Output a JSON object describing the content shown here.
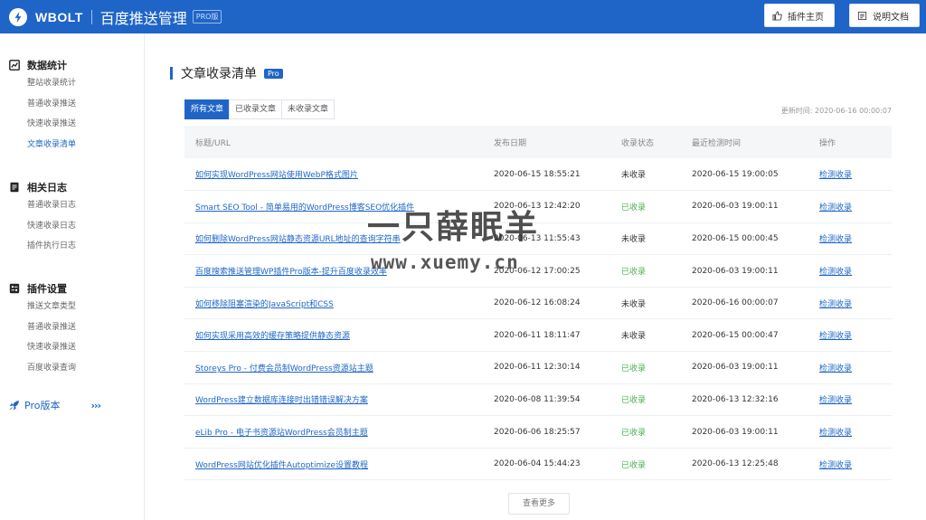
{
  "header": {
    "brand": "WBOLT",
    "app_title": "百度推送管理",
    "pro_tag": "PRO版",
    "plugin_home_label": "插件主页",
    "docs_label": "说明文档",
    "accent_color": "#1f65c7"
  },
  "sidebar": {
    "groups": [
      {
        "title": "数据统计",
        "icon": "chart-icon",
        "items": [
          {
            "label": "整站收录统计"
          },
          {
            "label": "普通收录推送"
          },
          {
            "label": "快速收录推送"
          },
          {
            "label": "文章收录清单",
            "active": true
          }
        ]
      },
      {
        "title": "相关日志",
        "icon": "log-icon",
        "items": [
          {
            "label": "普通收录日志"
          },
          {
            "label": "快速收录日志"
          },
          {
            "label": "插件执行日志"
          }
        ]
      },
      {
        "title": "插件设置",
        "icon": "settings-icon",
        "items": [
          {
            "label": "推送文章类型"
          },
          {
            "label": "普通收录推送"
          },
          {
            "label": "快速收录推送"
          },
          {
            "label": "百度收录查询"
          }
        ]
      }
    ],
    "pro_label": "Pro版本",
    "pro_arrows": "›››"
  },
  "main": {
    "section_title": "文章收录清单",
    "section_badge": "Pro",
    "tabs": [
      {
        "label": "所有文章",
        "active": true
      },
      {
        "label": "已收录文章"
      },
      {
        "label": "未收录文章"
      }
    ],
    "updated": "更新时间: 2020-06-16 00:00:07",
    "columns": [
      "标题/URL",
      "发布日期",
      "收录状态",
      "最近检测时间",
      "操作"
    ],
    "rows": [
      {
        "title": "如何实现WordPress网站使用WebP格式图片",
        "date": "2020-06-15 18:55:21",
        "status": "未收录",
        "indexed": false,
        "checked": "2020-06-15 19:00:05",
        "action": "检测收录"
      },
      {
        "title": "Smart SEO Tool - 简单易用的WordPress博客SEO优化插件",
        "date": "2020-06-13 12:42:20",
        "status": "已收录",
        "indexed": true,
        "checked": "2020-06-03 19:00:11",
        "action": "检测收录"
      },
      {
        "title": "如何删除WordPress网站静态资源URL地址的查询字符串",
        "date": "2020-06-13 11:55:43",
        "status": "未收录",
        "indexed": false,
        "checked": "2020-06-15 00:00:45",
        "action": "检测收录"
      },
      {
        "title": "百度搜索推送管理WP插件Pro版本-提升百度收录效率",
        "date": "2020-06-12 17:00:25",
        "status": "已收录",
        "indexed": true,
        "checked": "2020-06-03 19:00:11",
        "action": "检测收录"
      },
      {
        "title": "如何移除阻塞渲染的JavaScript和CSS",
        "date": "2020-06-12 16:08:24",
        "status": "未收录",
        "indexed": false,
        "checked": "2020-06-16 00:00:07",
        "action": "检测收录"
      },
      {
        "title": "如何实现采用高效的缓存策略提供静态资源",
        "date": "2020-06-11 18:11:47",
        "status": "未收录",
        "indexed": false,
        "checked": "2020-06-15 00:00:47",
        "action": "检测收录"
      },
      {
        "title": "Storeys Pro - 付费会员制WordPress资源站主题",
        "date": "2020-06-11 12:30:14",
        "status": "已收录",
        "indexed": true,
        "checked": "2020-06-03 19:00:11",
        "action": "检测收录"
      },
      {
        "title": "WordPress建立数据库连接时出错错误解决方案",
        "date": "2020-06-08 11:39:54",
        "status": "已收录",
        "indexed": true,
        "checked": "2020-06-13 12:32:16",
        "action": "检测收录"
      },
      {
        "title": "eLib Pro - 电子书资源站WordPress会员制主题",
        "date": "2020-06-06 18:25:57",
        "status": "已收录",
        "indexed": true,
        "checked": "2020-06-03 19:00:11",
        "action": "检测收录"
      },
      {
        "title": "WordPress网站优化插件Autoptimize设置教程",
        "date": "2020-06-04 15:44:23",
        "status": "已收录",
        "indexed": true,
        "checked": "2020-06-13 12:25:48",
        "action": "检测收录"
      }
    ],
    "more_label": "查看更多"
  },
  "watermark": {
    "line1": "一只薛眠羊",
    "line2": "www.xuemy.cn"
  }
}
